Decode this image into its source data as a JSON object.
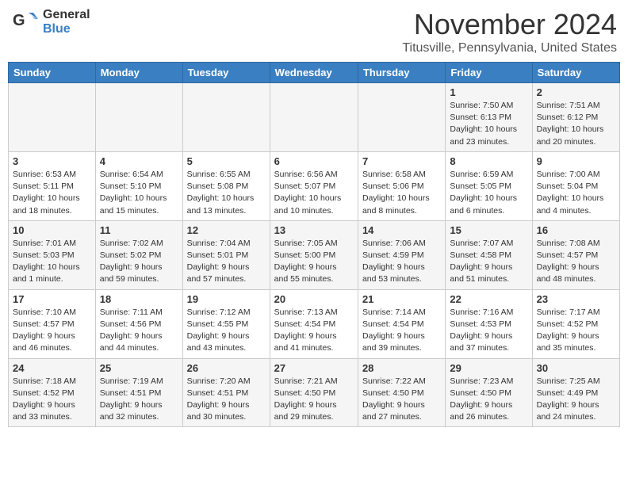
{
  "header": {
    "logo_general": "General",
    "logo_blue": "Blue",
    "month_title": "November 2024",
    "location": "Titusville, Pennsylvania, United States"
  },
  "days_of_week": [
    "Sunday",
    "Monday",
    "Tuesday",
    "Wednesday",
    "Thursday",
    "Friday",
    "Saturday"
  ],
  "weeks": [
    [
      {
        "day": "",
        "info": ""
      },
      {
        "day": "",
        "info": ""
      },
      {
        "day": "",
        "info": ""
      },
      {
        "day": "",
        "info": ""
      },
      {
        "day": "",
        "info": ""
      },
      {
        "day": "1",
        "info": "Sunrise: 7:50 AM\nSunset: 6:13 PM\nDaylight: 10 hours\nand 23 minutes."
      },
      {
        "day": "2",
        "info": "Sunrise: 7:51 AM\nSunset: 6:12 PM\nDaylight: 10 hours\nand 20 minutes."
      }
    ],
    [
      {
        "day": "3",
        "info": "Sunrise: 6:53 AM\nSunset: 5:11 PM\nDaylight: 10 hours\nand 18 minutes."
      },
      {
        "day": "4",
        "info": "Sunrise: 6:54 AM\nSunset: 5:10 PM\nDaylight: 10 hours\nand 15 minutes."
      },
      {
        "day": "5",
        "info": "Sunrise: 6:55 AM\nSunset: 5:08 PM\nDaylight: 10 hours\nand 13 minutes."
      },
      {
        "day": "6",
        "info": "Sunrise: 6:56 AM\nSunset: 5:07 PM\nDaylight: 10 hours\nand 10 minutes."
      },
      {
        "day": "7",
        "info": "Sunrise: 6:58 AM\nSunset: 5:06 PM\nDaylight: 10 hours\nand 8 minutes."
      },
      {
        "day": "8",
        "info": "Sunrise: 6:59 AM\nSunset: 5:05 PM\nDaylight: 10 hours\nand 6 minutes."
      },
      {
        "day": "9",
        "info": "Sunrise: 7:00 AM\nSunset: 5:04 PM\nDaylight: 10 hours\nand 4 minutes."
      }
    ],
    [
      {
        "day": "10",
        "info": "Sunrise: 7:01 AM\nSunset: 5:03 PM\nDaylight: 10 hours\nand 1 minute."
      },
      {
        "day": "11",
        "info": "Sunrise: 7:02 AM\nSunset: 5:02 PM\nDaylight: 9 hours\nand 59 minutes."
      },
      {
        "day": "12",
        "info": "Sunrise: 7:04 AM\nSunset: 5:01 PM\nDaylight: 9 hours\nand 57 minutes."
      },
      {
        "day": "13",
        "info": "Sunrise: 7:05 AM\nSunset: 5:00 PM\nDaylight: 9 hours\nand 55 minutes."
      },
      {
        "day": "14",
        "info": "Sunrise: 7:06 AM\nSunset: 4:59 PM\nDaylight: 9 hours\nand 53 minutes."
      },
      {
        "day": "15",
        "info": "Sunrise: 7:07 AM\nSunset: 4:58 PM\nDaylight: 9 hours\nand 51 minutes."
      },
      {
        "day": "16",
        "info": "Sunrise: 7:08 AM\nSunset: 4:57 PM\nDaylight: 9 hours\nand 48 minutes."
      }
    ],
    [
      {
        "day": "17",
        "info": "Sunrise: 7:10 AM\nSunset: 4:57 PM\nDaylight: 9 hours\nand 46 minutes."
      },
      {
        "day": "18",
        "info": "Sunrise: 7:11 AM\nSunset: 4:56 PM\nDaylight: 9 hours\nand 44 minutes."
      },
      {
        "day": "19",
        "info": "Sunrise: 7:12 AM\nSunset: 4:55 PM\nDaylight: 9 hours\nand 43 minutes."
      },
      {
        "day": "20",
        "info": "Sunrise: 7:13 AM\nSunset: 4:54 PM\nDaylight: 9 hours\nand 41 minutes."
      },
      {
        "day": "21",
        "info": "Sunrise: 7:14 AM\nSunset: 4:54 PM\nDaylight: 9 hours\nand 39 minutes."
      },
      {
        "day": "22",
        "info": "Sunrise: 7:16 AM\nSunset: 4:53 PM\nDaylight: 9 hours\nand 37 minutes."
      },
      {
        "day": "23",
        "info": "Sunrise: 7:17 AM\nSunset: 4:52 PM\nDaylight: 9 hours\nand 35 minutes."
      }
    ],
    [
      {
        "day": "24",
        "info": "Sunrise: 7:18 AM\nSunset: 4:52 PM\nDaylight: 9 hours\nand 33 minutes."
      },
      {
        "day": "25",
        "info": "Sunrise: 7:19 AM\nSunset: 4:51 PM\nDaylight: 9 hours\nand 32 minutes."
      },
      {
        "day": "26",
        "info": "Sunrise: 7:20 AM\nSunset: 4:51 PM\nDaylight: 9 hours\nand 30 minutes."
      },
      {
        "day": "27",
        "info": "Sunrise: 7:21 AM\nSunset: 4:50 PM\nDaylight: 9 hours\nand 29 minutes."
      },
      {
        "day": "28",
        "info": "Sunrise: 7:22 AM\nSunset: 4:50 PM\nDaylight: 9 hours\nand 27 minutes."
      },
      {
        "day": "29",
        "info": "Sunrise: 7:23 AM\nSunset: 4:50 PM\nDaylight: 9 hours\nand 26 minutes."
      },
      {
        "day": "30",
        "info": "Sunrise: 7:25 AM\nSunset: 4:49 PM\nDaylight: 9 hours\nand 24 minutes."
      }
    ]
  ]
}
